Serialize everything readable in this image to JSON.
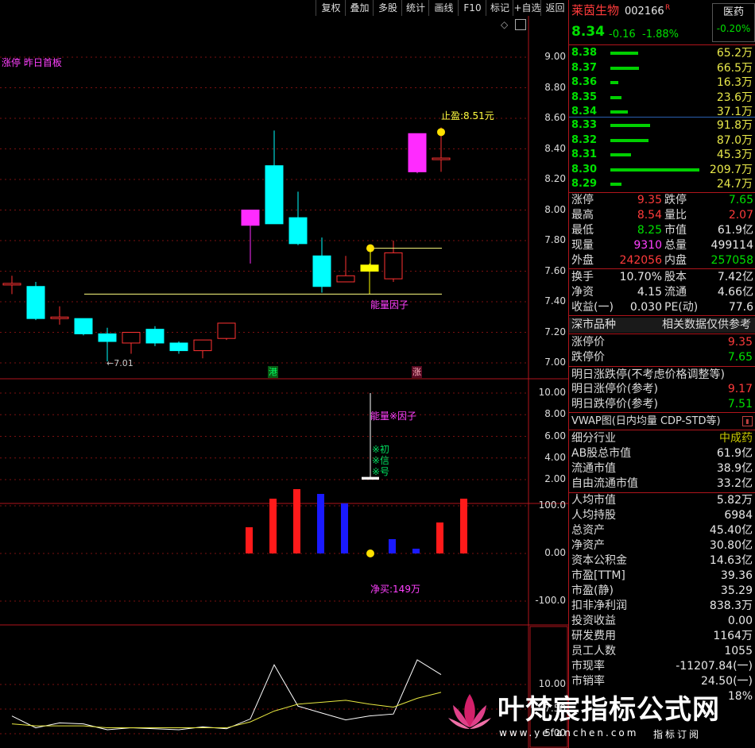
{
  "toolbar": [
    "复权",
    "叠加",
    "多股",
    "统计",
    "画线",
    "F10",
    "标记",
    "+自选",
    "返回"
  ],
  "chart": {
    "main_label_a": "涨停",
    "main_label_b": "昨日首板",
    "stop_profit": "止盈:8.51元",
    "low_mark": "←7.01",
    "factor_label": "能量因子",
    "tag_hk": "港",
    "tag_up": "涨",
    "y_main": [
      "9.00",
      "8.80",
      "8.60",
      "8.40",
      "8.20",
      "8.00",
      "7.80",
      "7.60",
      "7.40",
      "7.20",
      "7.00"
    ],
    "sub1_label": "能量※因子",
    "sub1_notes": [
      "※初",
      "※信",
      "※号"
    ],
    "y_sub1": [
      "10.00",
      "8.00",
      "6.00",
      "4.00",
      "2.00"
    ],
    "sub2_label": "净买:149万",
    "y_sub2": [
      "100.0",
      "0.00",
      "-100.0"
    ],
    "y_sub3": [
      "10.00",
      "7.50",
      "5.00"
    ],
    "colors": {
      "up": "#ff3232",
      "down": "#00ffff",
      "limit": "#ff2bff",
      "yellow": "#ffff00",
      "grid": "#7a1010"
    }
  },
  "chart_data": {
    "type": "candlestick",
    "candles": [
      {
        "o": 7.52,
        "c": 7.52,
        "h": 7.57,
        "l": 7.45
      },
      {
        "o": 7.5,
        "c": 7.29,
        "h": 7.53,
        "l": 7.28
      },
      {
        "o": 7.3,
        "c": 7.3,
        "h": 7.37,
        "l": 7.25
      },
      {
        "o": 7.29,
        "c": 7.19,
        "h": 7.29,
        "l": 7.18
      },
      {
        "o": 7.19,
        "c": 7.14,
        "h": 7.23,
        "l": 7.01
      },
      {
        "o": 7.13,
        "c": 7.2,
        "h": 7.2,
        "l": 7.06
      },
      {
        "o": 7.22,
        "c": 7.13,
        "h": 7.24,
        "l": 7.11
      },
      {
        "o": 7.13,
        "c": 7.08,
        "h": 7.14,
        "l": 7.06
      },
      {
        "o": 7.08,
        "c": 7.15,
        "h": 7.15,
        "l": 7.03
      },
      {
        "o": 7.16,
        "c": 7.26,
        "h": 7.26,
        "l": 7.15
      },
      {
        "o": 7.9,
        "c": 8.0,
        "h": 8.0,
        "l": 7.65,
        "limit": true
      },
      {
        "o": 8.29,
        "c": 7.91,
        "h": 8.52,
        "l": 7.91
      },
      {
        "o": 7.95,
        "c": 7.78,
        "h": 8.12,
        "l": 7.77
      },
      {
        "o": 7.7,
        "c": 7.5,
        "h": 7.82,
        "l": 7.46
      },
      {
        "o": 7.53,
        "c": 7.57,
        "h": 7.7,
        "l": 7.53
      },
      {
        "o": 7.6,
        "c": 7.64,
        "h": 7.65,
        "l": 7.45,
        "yellow": true
      },
      {
        "o": 7.55,
        "c": 7.72,
        "h": 7.8,
        "l": 7.53
      },
      {
        "o": 8.25,
        "c": 8.5,
        "h": 8.5,
        "l": 8.24,
        "limit": true
      },
      {
        "o": 8.34,
        "c": 8.34,
        "h": 8.54,
        "l": 8.25
      }
    ],
    "hlines": [
      7.45,
      7.75
    ],
    "factor_bar": 2.1,
    "net_buy": [
      null,
      null,
      null,
      null,
      null,
      null,
      null,
      null,
      null,
      null,
      55,
      115,
      135,
      125,
      105,
      null,
      30,
      10,
      65,
      115
    ],
    "net_buy_colors": [
      "",
      "",
      "",
      "",
      "",
      "",
      "",
      "",
      "",
      "",
      "r",
      "r",
      "r",
      "b",
      "b",
      "",
      "b",
      "b",
      "r",
      "r"
    ],
    "line_white": [
      6.8,
      5.6,
      6.1,
      6.0,
      5.4,
      5.6,
      5.5,
      5.4,
      5.7,
      5.5,
      6.5,
      12.0,
      7.8,
      7.1,
      6.4,
      6.8,
      7.0,
      12.5,
      11.0
    ],
    "line_yellow": [
      6.0,
      5.8,
      5.8,
      5.8,
      5.6,
      5.6,
      5.6,
      5.6,
      5.6,
      5.6,
      6.2,
      7.3,
      8.0,
      8.2,
      8.4,
      8.0,
      7.7,
      8.6,
      9.2
    ]
  },
  "panel": {
    "name": "莱茵生物",
    "code": "002166",
    "flag": "R",
    "sector": "医药",
    "sector_chg": "-0.20%",
    "price": "8.34",
    "chg": "-0.16",
    "pct": "-1.88%",
    "asks": [
      {
        "p": "8.38",
        "v": "65.2万",
        "w": 35
      },
      {
        "p": "8.37",
        "v": "66.5万",
        "w": 36
      },
      {
        "p": "8.36",
        "v": "16.3万",
        "w": 10
      },
      {
        "p": "8.35",
        "v": "23.6万",
        "w": 14
      },
      {
        "p": "8.34",
        "v": "37.1万",
        "w": 22
      }
    ],
    "bids": [
      {
        "p": "8.33",
        "v": "91.8万",
        "w": 50
      },
      {
        "p": "8.32",
        "v": "87.0万",
        "w": 48
      },
      {
        "p": "8.31",
        "v": "45.3万",
        "w": 26
      },
      {
        "p": "8.30",
        "v": "209.7万",
        "w": 112
      },
      {
        "p": "8.29",
        "v": "24.7万",
        "w": 14
      }
    ],
    "stats1": [
      {
        "l1": "涨停",
        "v1": "9.35",
        "c1": "red",
        "l2": "跌停",
        "v2": "7.65",
        "c2": "grn"
      },
      {
        "l1": "最高",
        "v1": "8.54",
        "c1": "red",
        "l2": "量比",
        "v2": "2.07",
        "c2": "red"
      },
      {
        "l1": "最低",
        "v1": "8.25",
        "c1": "grn",
        "l2": "市值",
        "v2": "61.9亿",
        "c2": "wht"
      },
      {
        "l1": "现量",
        "v1": "9310",
        "c1": "mag",
        "l2": "总量",
        "v2": "499114",
        "c2": "wht"
      },
      {
        "l1": "外盘",
        "v1": "242056",
        "c1": "red",
        "l2": "内盘",
        "v2": "257058",
        "c2": "grn"
      }
    ],
    "stats2": [
      {
        "l1": "换手",
        "v1": "10.70%",
        "l2": "股本",
        "v2": "7.42亿"
      },
      {
        "l1": "净资",
        "v1": "4.15",
        "l2": "流通",
        "v2": "4.66亿"
      },
      {
        "l1": "收益(一)",
        "v1": "0.030",
        "l2": "PE(动)",
        "v2": "77.6"
      }
    ],
    "market_row": {
      "left": "深市品种",
      "right": "相关数据仅供参考"
    },
    "limit_rows": [
      {
        "l": "涨停价",
        "v": "9.35",
        "c": "red"
      },
      {
        "l": "跌停价",
        "v": "7.65",
        "c": "grn"
      }
    ],
    "tomorrow_title": "明日涨跌停(不考虑价格调整等)",
    "tomorrow_rows": [
      {
        "l": "明日涨停价(参考)",
        "v": "9.17",
        "c": "red"
      },
      {
        "l": "明日跌停价(参考)",
        "v": "7.51",
        "c": "grn"
      }
    ],
    "vwap": "VWAP图(日内均量 CDP-STD等)",
    "industry": {
      "l": "细分行业",
      "v": "中成药"
    },
    "caps": [
      {
        "l": "AB股总市值",
        "v": "61.9亿"
      },
      {
        "l": "流通市值",
        "v": "38.9亿"
      },
      {
        "l": "自由流通市值",
        "v": "33.2亿"
      }
    ],
    "fund": [
      {
        "l": "人均市值",
        "v": "5.82万"
      },
      {
        "l": "人均持股",
        "v": "6984"
      },
      {
        "l": "总资产",
        "v": "45.40亿"
      },
      {
        "l": "净资产",
        "v": "30.80亿"
      },
      {
        "l": "资本公积金",
        "v": "14.63亿"
      },
      {
        "l": "市盈[TTM]",
        "v": "39.36"
      },
      {
        "l": "市盈(静)",
        "v": "35.29"
      },
      {
        "l": "扣非净利润",
        "v": "838.3万"
      },
      {
        "l": "投资收益",
        "v": "0.00"
      },
      {
        "l": "研发费用",
        "v": "1164万"
      },
      {
        "l": "员工人数",
        "v": "1055"
      },
      {
        "l": "市现率",
        "v": "-11207.84(一)"
      },
      {
        "l": "市销率",
        "v": "24.50(一)"
      },
      {
        "l": "",
        "v": "18%"
      }
    ]
  },
  "watermark": {
    "title": "叶梵宸指标公式网",
    "url": "www.yefanchen.com",
    "tag": "指标订阅"
  }
}
